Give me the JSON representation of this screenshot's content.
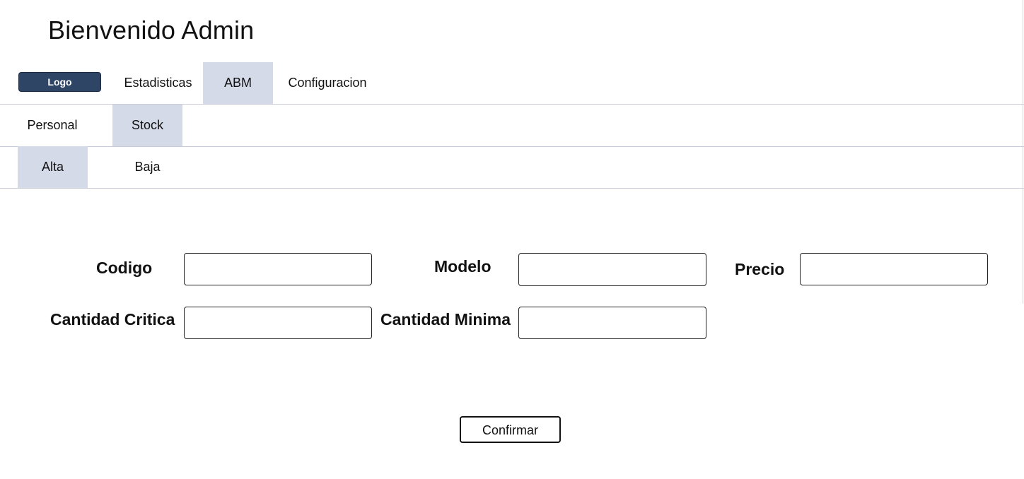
{
  "header": {
    "title": "Bienvenido Admin"
  },
  "main_nav": {
    "logo_label": "Logo",
    "tabs": [
      {
        "label": "Estadisticas",
        "active": false
      },
      {
        "label": "ABM",
        "active": true
      },
      {
        "label": "Configuracion",
        "active": false
      }
    ]
  },
  "abm_nav": {
    "tabs": [
      {
        "label": "Personal",
        "active": false
      },
      {
        "label": "Stock",
        "active": true
      }
    ]
  },
  "stock_nav": {
    "tabs": [
      {
        "label": "Alta",
        "active": true
      },
      {
        "label": "Baja",
        "active": false
      }
    ]
  },
  "form": {
    "codigo": {
      "label": "Codigo",
      "value": ""
    },
    "modelo": {
      "label": "Modelo",
      "value": ""
    },
    "precio": {
      "label": "Precio",
      "value": ""
    },
    "cantidad_critica": {
      "label": "Cantidad Critica",
      "value": ""
    },
    "cantidad_minima": {
      "label": "Cantidad Minima",
      "value": ""
    },
    "confirm_label": "Confirmar"
  },
  "colors": {
    "logo_bg": "#2f4566",
    "active_tab_bg": "#d4dae8",
    "divider": "#c9ccd6"
  }
}
